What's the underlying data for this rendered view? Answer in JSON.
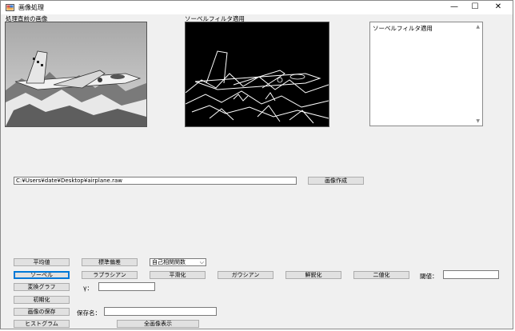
{
  "window": {
    "title": "画像処理",
    "controls": {
      "minimize": "—",
      "maximize": "☐",
      "close": "✕"
    }
  },
  "labels": {
    "original_image": "処理直前の画像",
    "filtered_image": "ソーベルフィルタ適用",
    "gamma": "γ：",
    "threshold": "閾値：",
    "save_name": "保存名："
  },
  "history_list": {
    "items": [
      "ソーベルフィルタ適用"
    ]
  },
  "file_path": {
    "value": "C:¥Users¥date¥Desktop¥airplane.raw"
  },
  "buttons": {
    "create_image": "画像作成",
    "average": "平均値",
    "std_dev": "標準偏差",
    "sobel": "ソーベル",
    "laplacian": "ラプラシアン",
    "smoothing": "平滑化",
    "gaussian": "ガウシアン",
    "sharpen": "鮮鋭化",
    "binarize": "二値化",
    "tone_curve": "変換グラフ",
    "initialize": "初期化",
    "save_image": "画像の保存",
    "histogram": "ヒストグラム",
    "show_all": "全画像表示"
  },
  "combo": {
    "selected": "自己相関関数"
  },
  "inputs": {
    "gamma": "",
    "threshold": "",
    "save_name": ""
  }
}
